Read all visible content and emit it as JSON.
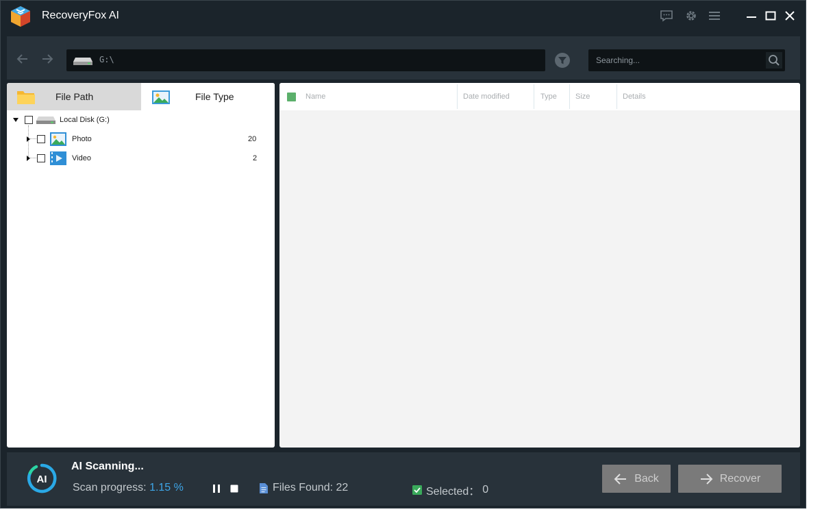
{
  "app": {
    "title": "RecoveryFox AI"
  },
  "toolbar": {
    "path": "G:\\",
    "search_placeholder": "Searching..."
  },
  "left_panel": {
    "tabs": [
      {
        "label": "File Path",
        "active": true
      },
      {
        "label": "File Type",
        "active": false
      }
    ],
    "tree": {
      "root": {
        "label": "Local Disk (G:)"
      },
      "children": [
        {
          "label": "Photo",
          "count": "20"
        },
        {
          "label": "Video",
          "count": "2"
        }
      ]
    }
  },
  "file_list": {
    "columns": [
      "Name",
      "Date modified",
      "Type",
      "Size",
      "Details"
    ],
    "rows": []
  },
  "status": {
    "title": "AI Scanning...",
    "progress_label": "Scan progress:",
    "progress_value": "1.15 %",
    "progress_fraction": 0.0115,
    "files_found": "Files Found: 22",
    "selected_label": "Selected：",
    "selected_count": "0",
    "back_label": "Back",
    "recover_label": "Recover"
  },
  "colors": {
    "window_bg": "#1b242b",
    "panel_bg": "#28323a",
    "accent_blue": "#3ea6e8",
    "check_green": "#5bb06b",
    "disabled_button": "#7a7a7a"
  }
}
